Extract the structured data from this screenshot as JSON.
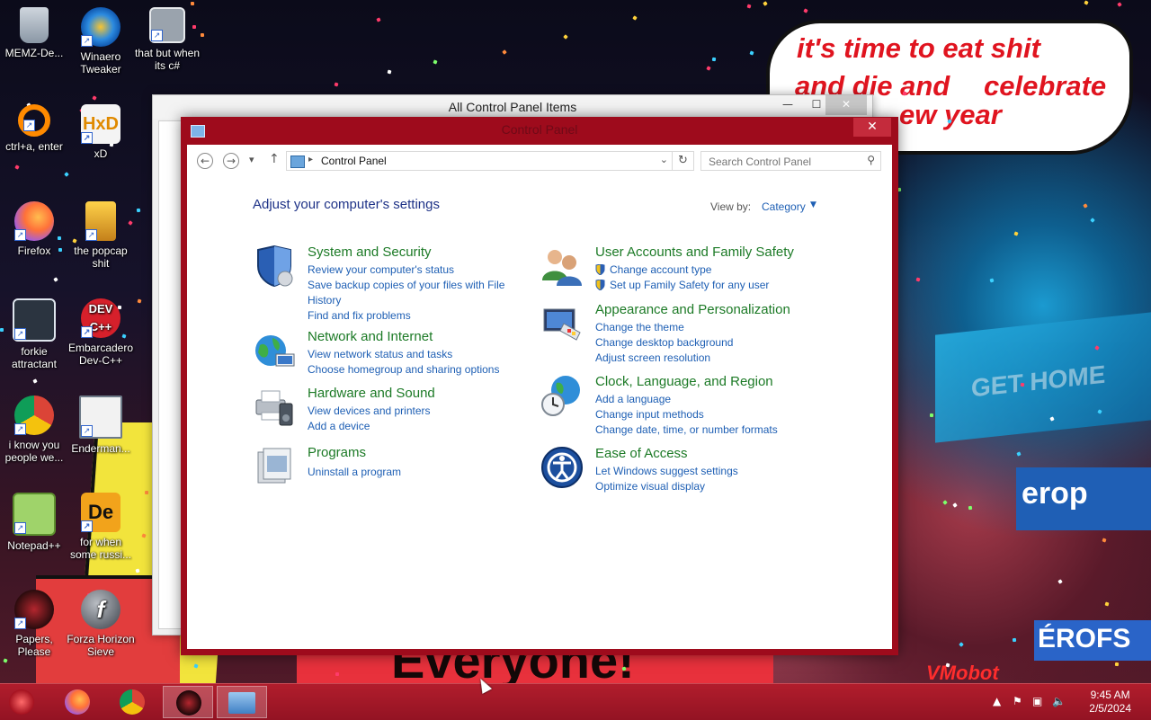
{
  "desktop": {
    "meme_line1": "it's time to eat shit",
    "meme_line2": "and die and",
    "meme_line3": "celebrate",
    "meme_line4": "ew year",
    "sign_gethome": "GET HOME",
    "sign_ero": "erop",
    "sign_erofs": "ÉROFS",
    "banner_text": "Everyone!",
    "watermark": "VMobot",
    "icons": [
      {
        "label": "MEMZ-De...",
        "icon": "recycle-bin-icon"
      },
      {
        "label": "Winaero Tweaker",
        "icon": "winaero-icon"
      },
      {
        "label": "that but when its c#",
        "icon": "stacked-windows-icon"
      },
      {
        "label": "ctrl+a, enter",
        "icon": "ring-icon"
      },
      {
        "label": "xD",
        "icon": "hxd-icon"
      },
      {
        "label": "Firefox",
        "icon": "firefox-icon"
      },
      {
        "label": "the popcap shit",
        "icon": "popcap-icon"
      },
      {
        "label": "forkie attractant",
        "icon": "settings-monitor-icon"
      },
      {
        "label": "Embarcadero Dev-C++",
        "icon": "devcpp-icon"
      },
      {
        "label": "i know you people we...",
        "icon": "chrome-icon"
      },
      {
        "label": "Enderman...",
        "icon": "window-icon"
      },
      {
        "label": "Notepad++",
        "icon": "notepadpp-icon"
      },
      {
        "label": "for when some russi...",
        "icon": "de-icon"
      },
      {
        "label": "Papers, Please",
        "icon": "papers-please-icon"
      },
      {
        "label": "Forza Horizon Sieve",
        "icon": "flash-icon"
      }
    ]
  },
  "back_window": {
    "title": "All Control Panel Items",
    "minimize": "—",
    "maximize": "☐",
    "close": "✕"
  },
  "main_window": {
    "title": "Control Panel",
    "close": "✕",
    "address": {
      "path": "Control Panel"
    },
    "search": {
      "placeholder": "Search Control Panel"
    },
    "heading": "Adjust your computer's settings",
    "view_by_label": "View by:",
    "view_by_value": "Category",
    "categories_left": [
      {
        "title": "System and Security",
        "icon": "shield-icon",
        "links": [
          "Review your computer's status",
          "Save backup copies of your files with File History",
          "Find and fix problems"
        ]
      },
      {
        "title": "Network and Internet",
        "icon": "globe-network-icon",
        "links": [
          "View network status and tasks",
          "Choose homegroup and sharing options"
        ]
      },
      {
        "title": "Hardware and Sound",
        "icon": "printer-speaker-icon",
        "links": [
          "View devices and printers",
          "Add a device"
        ]
      },
      {
        "title": "Programs",
        "icon": "programs-box-icon",
        "links": [
          "Uninstall a program"
        ]
      }
    ],
    "categories_right": [
      {
        "title": "User Accounts and Family Safety",
        "icon": "users-icon",
        "links": [
          "Change account type",
          "Set up Family Safety for any user"
        ]
      },
      {
        "title": "Appearance and Personalization",
        "icon": "display-palette-icon",
        "links": [
          "Change the theme",
          "Change desktop background",
          "Adjust screen resolution"
        ]
      },
      {
        "title": "Clock, Language, and Region",
        "icon": "clock-globe-icon",
        "links": [
          "Add a language",
          "Change input methods",
          "Change date, time, or number formats"
        ]
      },
      {
        "title": "Ease of Access",
        "icon": "ease-of-access-icon",
        "links": [
          "Let Windows suggest settings",
          "Optimize visual display"
        ]
      }
    ]
  },
  "taskbar": {
    "items": [
      "start-button",
      "firefox-icon",
      "chrome-icon",
      "papers-please-icon",
      "control-panel-icon"
    ],
    "clock_time": "9:45 AM",
    "clock_date": "2/5/2024"
  },
  "colors": {
    "accent_frame": "#9e0b1c",
    "taskbar": "#b11d2c",
    "category_title": "#1c7a26",
    "link": "#1e5fb4",
    "heading": "#1e3287"
  }
}
